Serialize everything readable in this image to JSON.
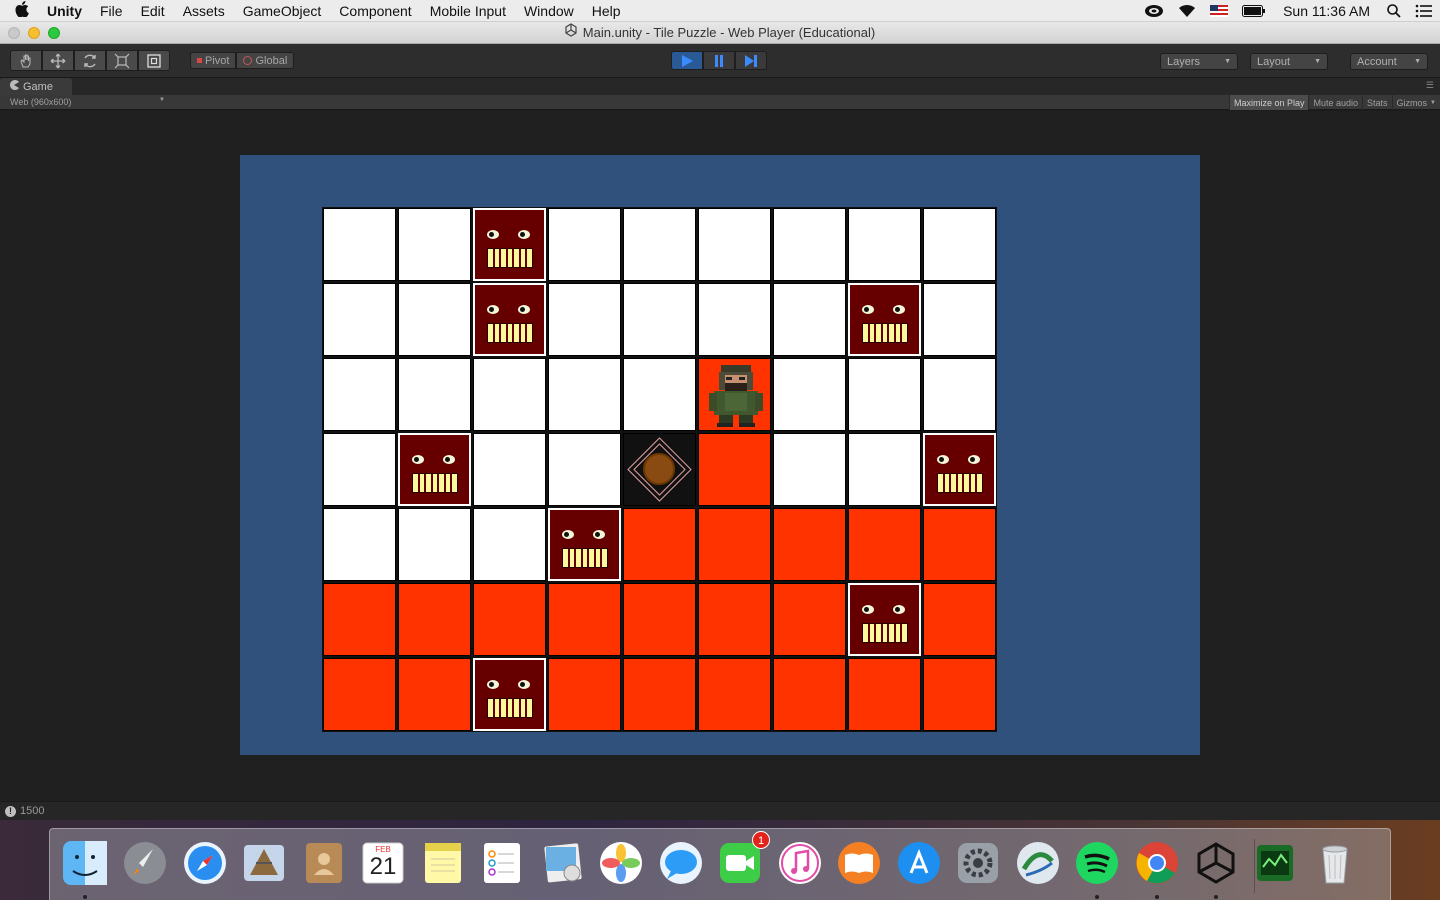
{
  "menubar": {
    "app_name": "Unity",
    "items": [
      "File",
      "Edit",
      "Assets",
      "GameObject",
      "Component",
      "Mobile Input",
      "Window",
      "Help"
    ],
    "clock": "Sun 11:36 AM"
  },
  "window": {
    "title": "Main.unity - Tile Puzzle - Web Player (Educational)"
  },
  "toolbar": {
    "pivot_label": "Pivot",
    "global_label": "Global",
    "layers_label": "Layers",
    "layout_label": "Layout",
    "account_label": "Account"
  },
  "game_panel": {
    "tab_label": "Game",
    "resolution_label": "Web (960x600)",
    "options": [
      "Maximize on Play",
      "Mute audio",
      "Stats",
      "Gizmos"
    ],
    "active_option": "Maximize on Play"
  },
  "board": {
    "cols": 9,
    "rows": 7,
    "cells": [
      [
        "white",
        "white",
        "monster",
        "white",
        "white",
        "white",
        "white",
        "white",
        "white"
      ],
      [
        "white",
        "white",
        "monster",
        "white",
        "white",
        "white",
        "white",
        "monster",
        "white"
      ],
      [
        "white",
        "white",
        "white",
        "white",
        "white",
        "player",
        "white",
        "white",
        "white"
      ],
      [
        "white",
        "monster",
        "white",
        "white",
        "target",
        "red",
        "white",
        "white",
        "monster"
      ],
      [
        "white",
        "white",
        "white",
        "monster",
        "red",
        "red",
        "red",
        "red",
        "red"
      ],
      [
        "red",
        "red",
        "red",
        "red",
        "red",
        "red",
        "red",
        "monster",
        "red"
      ],
      [
        "red",
        "red",
        "monster",
        "red",
        "red",
        "red",
        "red",
        "red",
        "red"
      ]
    ],
    "colors": {
      "white": "#ffffff",
      "red": "#ff3300",
      "target": "#f0f71e",
      "monster": "#660000",
      "stage": "#30517c"
    }
  },
  "status": {
    "text": "1500"
  },
  "dock": {
    "apps": [
      {
        "name": "finder-icon",
        "running": true
      },
      {
        "name": "launchpad-icon",
        "running": false
      },
      {
        "name": "safari-icon",
        "running": false
      },
      {
        "name": "mail-icon",
        "running": false
      },
      {
        "name": "contacts-icon",
        "running": false
      },
      {
        "name": "calendar-icon",
        "running": false,
        "month": "FEB",
        "day": "21"
      },
      {
        "name": "notes-icon",
        "running": false
      },
      {
        "name": "reminders-icon",
        "running": false
      },
      {
        "name": "preview-icon",
        "running": false
      },
      {
        "name": "photos-icon",
        "running": false
      },
      {
        "name": "messages-icon",
        "running": false
      },
      {
        "name": "facetime-icon",
        "running": false,
        "badge": "1"
      },
      {
        "name": "itunes-icon",
        "running": false
      },
      {
        "name": "ibooks-icon",
        "running": false
      },
      {
        "name": "app-store-icon",
        "running": false
      },
      {
        "name": "system-preferences-icon",
        "running": false
      },
      {
        "name": "network-icon",
        "running": false
      },
      {
        "name": "spotify-icon",
        "running": true
      },
      {
        "name": "chrome-icon",
        "running": true
      },
      {
        "name": "unity-icon",
        "running": true
      },
      {
        "name": "activity-monitor-icon",
        "running": false
      },
      {
        "name": "trash-icon",
        "running": false
      }
    ]
  }
}
